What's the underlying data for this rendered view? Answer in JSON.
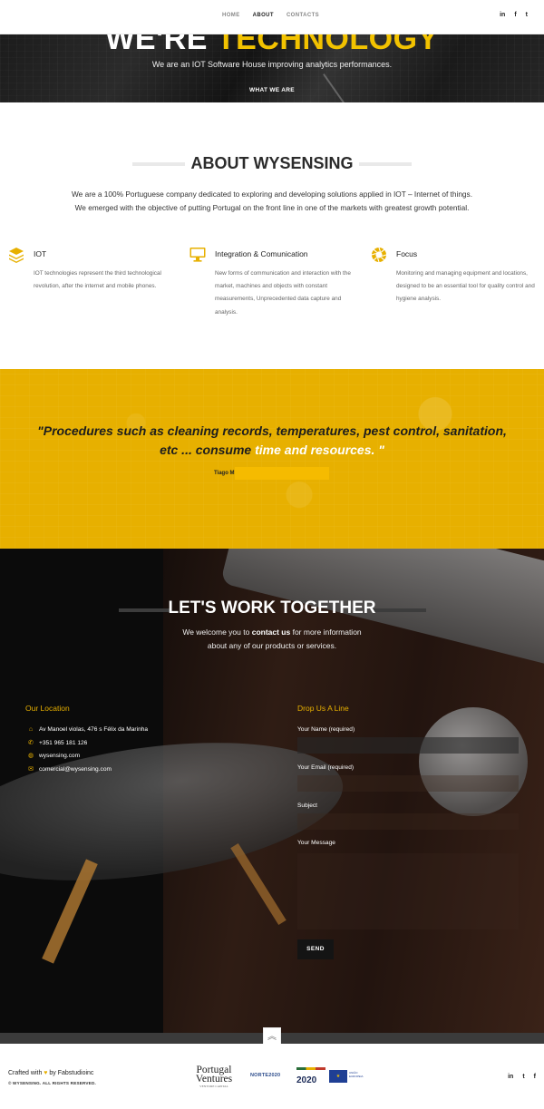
{
  "nav": {
    "items": [
      {
        "label": "HOME",
        "active": false
      },
      {
        "label": "ABOUT",
        "active": true
      },
      {
        "label": "CONTACTS",
        "active": false
      }
    ],
    "social": [
      "in",
      "f",
      "t"
    ]
  },
  "hero": {
    "title_part1": "WE'RE ",
    "title_part2": "TECHNOLOGY",
    "subtitle": "We are an IOT Software House improving analytics performances.",
    "button": "WHAT WE ARE"
  },
  "about": {
    "title": "ABOUT WYSENSING",
    "line1": "We are a 100% Portuguese company dedicated to exploring and developing solutions applied in IOT – Internet of things.",
    "line2": "We emerged with the objective of putting Portugal on the front line in one of the markets with greatest growth potential.",
    "features": [
      {
        "icon": "layers-icon",
        "title": "IOT",
        "text": "IOT technologies represent the third technological revolution, after the internet and mobile phones."
      },
      {
        "icon": "monitor-icon",
        "title": "Integration & Comunication",
        "text": "New forms of communication and interaction with the market, machines and objects with constant measurements, Unprecedented data capture and analysis."
      },
      {
        "icon": "aperture-icon",
        "title": "Focus",
        "text": "Monitoring and managing equipment and locations, designed to be an essential tool for quality control and hygiene analysis."
      }
    ]
  },
  "quote": {
    "text_dark": "\"Procedures such as cleaning records, temperatures, pest control, sanitation, etc ... consume ",
    "text_light": "time and resources.",
    "text_end": " \"",
    "author": "Tiago M"
  },
  "contact": {
    "title": "LET'S WORK TOGETHER",
    "sub_before": "We welcome you to ",
    "sub_link": "contact us",
    "sub_after": " for more information",
    "sub_line2": "about any of our products or services.",
    "location_title": "Our Location",
    "location_rows": [
      {
        "icon": "home-icon",
        "text": "Av Manoel violas, 476 s Félix da Marinha"
      },
      {
        "icon": "phone-icon",
        "text": "+351 965 181 126"
      },
      {
        "icon": "globe-icon",
        "text": "wysensing.com"
      },
      {
        "icon": "mail-icon",
        "text": "comercial@wysensing.com"
      }
    ],
    "form_title": "Drop Us A Line",
    "labels": {
      "name": "Your Name (required)",
      "email": "Your Email (required)",
      "subject": "Subject",
      "message": "Your Message"
    },
    "send": "SEND"
  },
  "footer": {
    "crafted_before": "Crafted with ",
    "crafted_after": " by Fabstudioinc",
    "copyright": "© WYSENSING. ALL RIGHTS RESERVED.",
    "logo_pv_line1": "Portugal",
    "logo_pv_line2": "Ventures",
    "logo_pv_small": "VENTURE CAPITAL",
    "logo_norte": "NORTE2020",
    "logo_p2020": "2020",
    "logo_eu_small": "UNIÃO EUROPEIA",
    "social": [
      "in",
      "t",
      "f"
    ]
  },
  "colors": {
    "accent": "#e7b000",
    "dark": "#0b0b0b"
  }
}
